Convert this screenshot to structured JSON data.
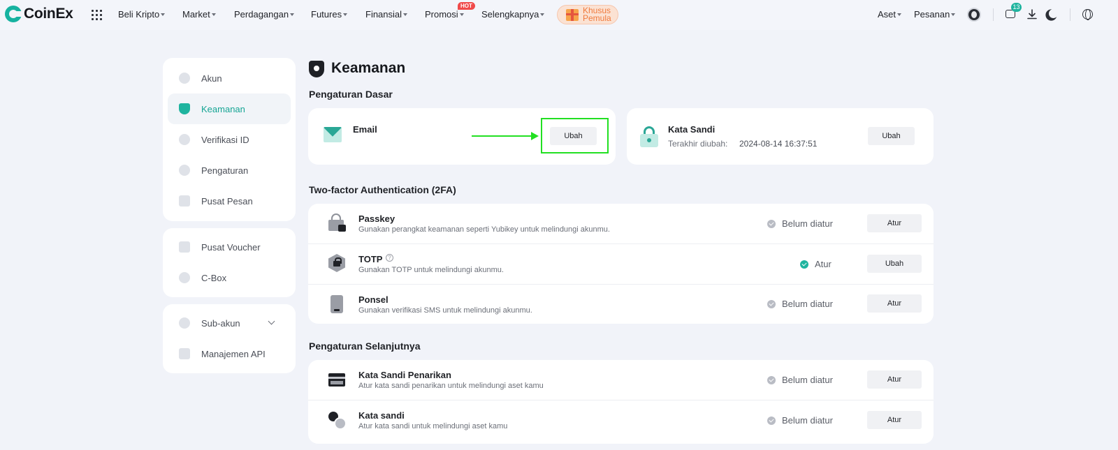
{
  "brand": {
    "name": "CoinEx"
  },
  "nav": {
    "beli_kripto": "Beli Kripto",
    "market": "Market",
    "perdagangan": "Perdagangan",
    "futures": "Futures",
    "finansial": "Finansial",
    "promosi": "Promosi",
    "hot_badge": "HOT",
    "selengkapnya": "Selengkapnya",
    "promo_line1": "Khusus",
    "promo_line2": "Pemula",
    "aset": "Aset",
    "pesanan": "Pesanan",
    "messages_count": "13"
  },
  "sidebar": {
    "group1": [
      "Akun",
      "Keamanan",
      "Verifikasi ID",
      "Pengaturan",
      "Pusat Pesan"
    ],
    "group2": [
      "Pusat Voucher",
      "C-Box"
    ],
    "group3": [
      "Sub-akun",
      "Manajemen API"
    ]
  },
  "page": {
    "title": "Keamanan",
    "section_basic": "Pengaturan Dasar",
    "section_2fa": "Two-factor Authentication (2FA)",
    "section_advanced": "Pengaturan Selanjutnya"
  },
  "basic": {
    "email": {
      "label": "Email",
      "button": "Ubah"
    },
    "password": {
      "label": "Kata Sandi",
      "last_changed_label": "Terakhir diubah:",
      "last_changed_value": "2024-08-14 16:37:51",
      "button": "Ubah"
    }
  },
  "twofa": [
    {
      "title": "Passkey",
      "desc": "Gunakan perangkat keamanan seperti Yubikey untuk melindungi akunmu.",
      "status": "Belum diatur",
      "button": "Atur"
    },
    {
      "title": "TOTP",
      "desc": "Gunakan TOTP untuk melindungi akunmu.",
      "status": "Atur",
      "button": "Ubah"
    },
    {
      "title": "Ponsel",
      "desc": "Gunakan verifikasi SMS untuk melindungi akunmu.",
      "status": "Belum diatur",
      "button": "Atur"
    }
  ],
  "advanced": [
    {
      "title": "Kata Sandi Penarikan",
      "desc": "Atur kata sandi penarikan untuk melindungi aset kamu",
      "status": "Belum diatur",
      "button": "Atur"
    },
    {
      "title": "Kata sandi",
      "desc": "Atur kata sandi untuk melindungi aset kamu",
      "status": "Belum diatur",
      "button": "Atur"
    }
  ],
  "colors": {
    "accent": "#1fb49f",
    "highlight": "#22e022",
    "hot": "#f04a4a"
  }
}
